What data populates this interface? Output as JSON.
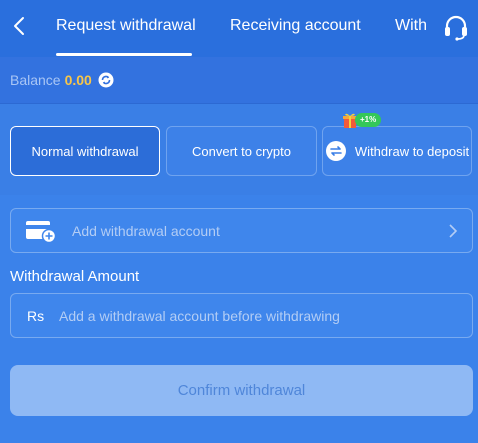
{
  "header": {
    "tabs": [
      {
        "label": "Request withdrawal",
        "active": true
      },
      {
        "label": "Receiving account",
        "active": false
      },
      {
        "label": "With",
        "active": false
      }
    ]
  },
  "balance": {
    "label": "Balance",
    "value": "0.00"
  },
  "methods": [
    {
      "label": "Normal withdrawal",
      "selected": true
    },
    {
      "label": "Convert to crypto",
      "selected": false
    },
    {
      "label": "Withdraw to deposit",
      "selected": false,
      "badge": "+1%"
    }
  ],
  "form": {
    "add_account_label": "Add withdrawal account",
    "amount_title": "Withdrawal Amount",
    "currency": "Rs",
    "amount_placeholder": "Add a withdrawal account before withdrawing",
    "amount_value": "",
    "confirm_label": "Confirm withdrawal"
  },
  "colors": {
    "accent": "#3a7fe6",
    "header": "#2a6fdd",
    "balance_value": "#f7c64a",
    "badge": "#34c759",
    "confirm_disabled": "#8fb9f4"
  },
  "icons": {
    "back": "chevron-left-icon",
    "support": "headset-icon",
    "refresh": "refresh-icon",
    "card": "card-add-icon",
    "swap": "swap-icon",
    "gift": "gift-icon",
    "chevron": "chevron-right-icon"
  }
}
